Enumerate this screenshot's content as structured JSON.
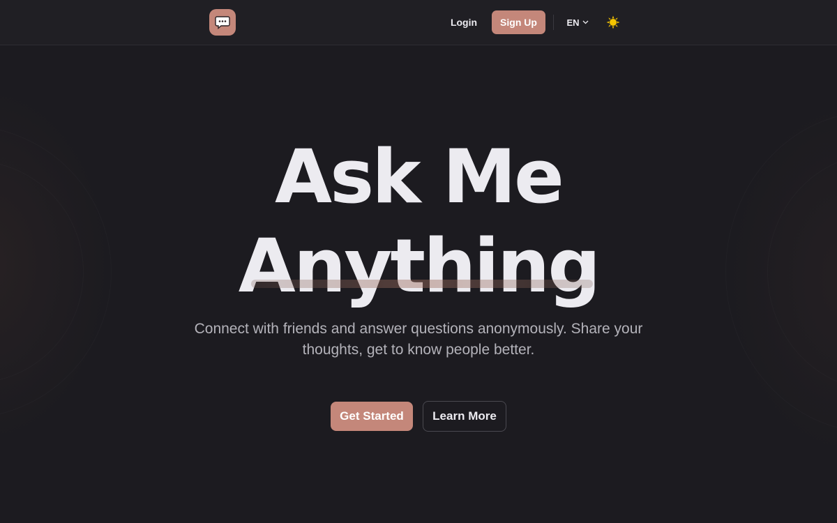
{
  "header": {
    "logo_icon": "chat-bubble-icon",
    "login_label": "Login",
    "signup_label": "Sign Up",
    "language": "EN",
    "language_icon": "chevron-down-icon",
    "theme_icon": "sun-icon"
  },
  "hero": {
    "title_line1": "Ask Me",
    "title_line2": "Anything",
    "subtitle": "Connect with friends and answer questions anonymously. Share your thoughts, get to know people better.",
    "primary_cta": "Get Started",
    "secondary_cta": "Learn More"
  },
  "colors": {
    "background": "#1c1b20",
    "header_background": "#201f24",
    "accent": "#c4877a",
    "text_primary": "#ecebf0",
    "text_secondary": "#b4b3ba"
  }
}
